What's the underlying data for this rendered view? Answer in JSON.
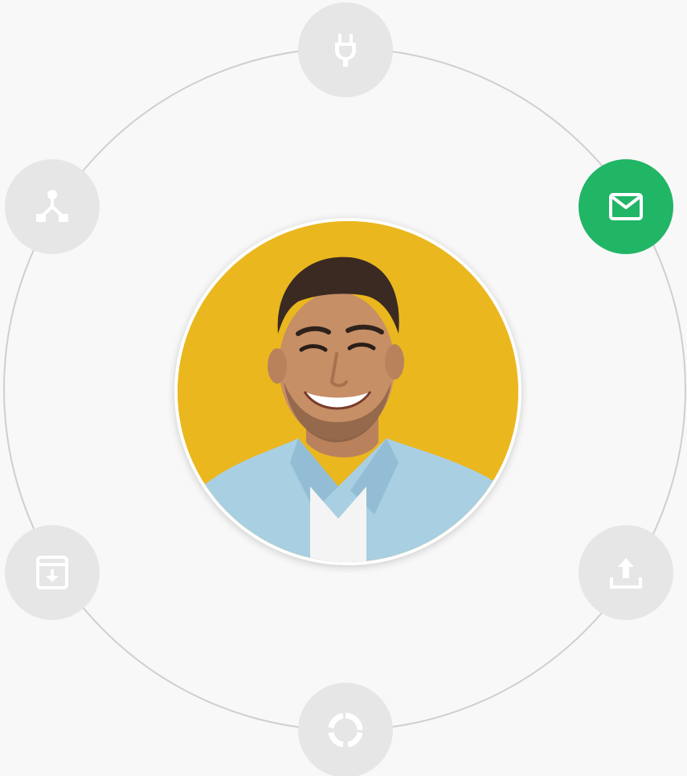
{
  "colors": {
    "background": "#f8f8f8",
    "ring": "#cfcfcf",
    "node_bg": "#e6e6e6",
    "node_icon": "#ffffff",
    "accent": "#21b566",
    "avatar_bg": "#ebb71f"
  },
  "nodes": [
    {
      "id": "plug",
      "icon": "plug-icon",
      "active": false
    },
    {
      "id": "share",
      "icon": "share-network-icon",
      "active": false
    },
    {
      "id": "mail",
      "icon": "mail-icon",
      "active": true
    },
    {
      "id": "archive",
      "icon": "archive-download-icon",
      "active": false
    },
    {
      "id": "upload",
      "icon": "upload-icon",
      "active": false
    },
    {
      "id": "refresh",
      "icon": "refresh-icon",
      "active": false
    }
  ],
  "avatar": {
    "subject": "profile-photo",
    "icon": "avatar-photo"
  }
}
